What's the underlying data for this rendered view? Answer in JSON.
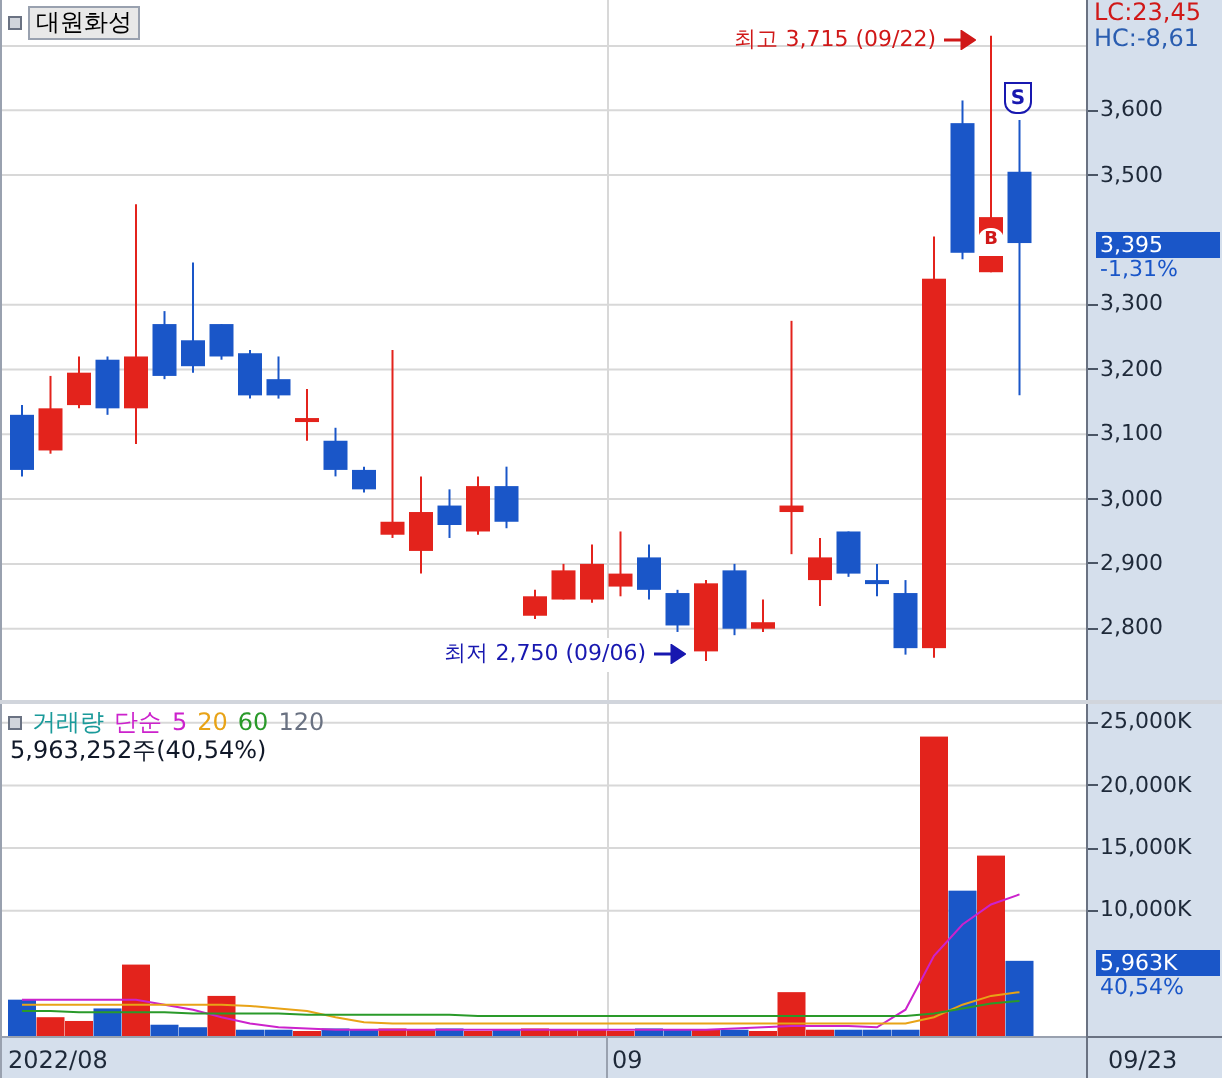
{
  "stock_name": "대원화성",
  "price_panel": {
    "lc": "LC:23,45",
    "hc": "HC:-8,61",
    "high_note": "최고 3,715 (09/22)",
    "low_note": "최저 2,750 (09/06)",
    "sell_marker": "S",
    "buy_marker": "B",
    "current_price": "3,395",
    "change": "-1,31%",
    "chart_data": {
      "type": "candlestick",
      "grid": true,
      "ylim": [
        2690,
        3770
      ],
      "yticks": [
        {
          "value": 3600,
          "label": "3,600"
        },
        {
          "value": 3500,
          "label": "3,500"
        },
        {
          "value": 3300,
          "label": "3,300"
        },
        {
          "value": 3200,
          "label": "3,200"
        },
        {
          "value": 3100,
          "label": "3,100"
        },
        {
          "value": 3000,
          "label": "3,000"
        },
        {
          "value": 2900,
          "label": "2,900"
        },
        {
          "value": 2800,
          "label": "2,800"
        }
      ],
      "ohlc": [
        [
          3130,
          3145,
          3035,
          3045
        ],
        [
          3075,
          3190,
          3070,
          3140
        ],
        [
          3145,
          3220,
          3140,
          3195
        ],
        [
          3215,
          3220,
          3130,
          3140
        ],
        [
          3140,
          3455,
          3085,
          3220
        ],
        [
          3270,
          3290,
          3185,
          3190
        ],
        [
          3245,
          3365,
          3195,
          3205
        ],
        [
          3270,
          3270,
          3215,
          3220
        ],
        [
          3225,
          3230,
          3155,
          3160
        ],
        [
          3185,
          3220,
          3155,
          3160
        ],
        [
          3120,
          3170,
          3090,
          3125
        ],
        [
          3090,
          3110,
          3035,
          3045
        ],
        [
          3045,
          3050,
          3010,
          3015
        ],
        [
          2945,
          3230,
          2940,
          2965
        ],
        [
          2920,
          3035,
          2885,
          2980
        ],
        [
          2990,
          3015,
          2940,
          2960
        ],
        [
          2950,
          3035,
          2945,
          3020
        ],
        [
          3020,
          3050,
          2955,
          2965
        ],
        [
          2820,
          2860,
          2815,
          2850
        ],
        [
          2845,
          2900,
          2845,
          2890
        ],
        [
          2845,
          2930,
          2840,
          2900
        ],
        [
          2865,
          2950,
          2850,
          2885
        ],
        [
          2910,
          2930,
          2845,
          2860
        ],
        [
          2855,
          2860,
          2795,
          2805
        ],
        [
          2765,
          2875,
          2750,
          2870
        ],
        [
          2890,
          2900,
          2790,
          2800
        ],
        [
          2800,
          2845,
          2795,
          2810
        ],
        [
          2980,
          3275,
          2915,
          2990
        ],
        [
          2875,
          2940,
          2835,
          2910
        ],
        [
          2950,
          2950,
          2880,
          2885
        ],
        [
          2875,
          2900,
          2850,
          2870
        ],
        [
          2855,
          2875,
          2760,
          2770
        ],
        [
          2770,
          3405,
          2755,
          3340
        ],
        [
          3580,
          3615,
          3370,
          3380
        ],
        [
          3350,
          3715,
          3350,
          3435
        ],
        [
          3505,
          3585,
          3160,
          3395
        ]
      ]
    }
  },
  "volume_panel": {
    "title": "거래량",
    "method": "단순",
    "extra_period": "120",
    "summary": "5,963,252주(40,54%)",
    "current_volume": "5,963K",
    "ratio": "40,54%",
    "chart_data": {
      "type": "bar",
      "grid": true,
      "ylim": [
        0,
        26500
      ],
      "yticks": [
        {
          "value": 10000,
          "label": "10,000K"
        },
        {
          "value": 15000,
          "label": "15,000K"
        },
        {
          "value": 20000,
          "label": "20,000K"
        },
        {
          "value": 25000,
          "label": "25,000K"
        }
      ],
      "series": [
        {
          "color": "#e3231c",
          "values": [
            null,
            1500,
            1200,
            null,
            5700,
            null,
            null,
            3200,
            null,
            null,
            400,
            null,
            null,
            600,
            500,
            null,
            400,
            null,
            600,
            500,
            500,
            400,
            null,
            null,
            500,
            null,
            400,
            3500,
            500,
            null,
            null,
            null,
            23900,
            null,
            14400,
            null
          ]
        },
        {
          "color": "#1a56c8",
          "values": [
            2900,
            null,
            null,
            2200,
            null,
            900,
            700,
            null,
            500,
            500,
            null,
            600,
            500,
            null,
            null,
            600,
            null,
            500,
            null,
            null,
            null,
            null,
            600,
            500,
            null,
            500,
            null,
            null,
            null,
            500,
            500,
            500,
            null,
            11600,
            null,
            6000
          ]
        },
        {
          "name": "5",
          "color": "#cc22cc",
          "type": "line",
          "values": [
            2900,
            2900,
            2900,
            2900,
            2900,
            2500,
            2100,
            1500,
            1000,
            700,
            600,
            500,
            500,
            500,
            500,
            500,
            500,
            500,
            500,
            500,
            500,
            500,
            500,
            500,
            500,
            600,
            700,
            800,
            800,
            800,
            700,
            2100,
            6400,
            8900,
            10500,
            11300
          ]
        },
        {
          "name": "20",
          "color": "#e8a317",
          "type": "line",
          "values": [
            2500,
            2500,
            2500,
            2500,
            2500,
            2500,
            2500,
            2500,
            2400,
            2200,
            2000,
            1500,
            1100,
            1000,
            1000,
            1000,
            1000,
            1000,
            1000,
            1000,
            1000,
            1000,
            1000,
            1000,
            1000,
            1000,
            1000,
            1000,
            1000,
            1000,
            1000,
            1000,
            1500,
            2500,
            3200,
            3500
          ]
        },
        {
          "name": "60",
          "color": "#2a9a2a",
          "type": "line",
          "values": [
            2000,
            2000,
            1900,
            1900,
            1900,
            1900,
            1800,
            1800,
            1800,
            1800,
            1700,
            1700,
            1700,
            1700,
            1700,
            1700,
            1600,
            1600,
            1600,
            1600,
            1600,
            1600,
            1600,
            1600,
            1600,
            1600,
            1600,
            1600,
            1600,
            1600,
            1600,
            1600,
            1800,
            2200,
            2600,
            2800
          ]
        }
      ]
    }
  },
  "date_axis": [
    "2022/08",
    "09",
    "09/23"
  ]
}
